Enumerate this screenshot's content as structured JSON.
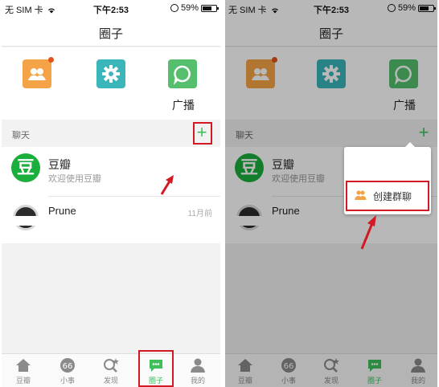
{
  "status_bar": {
    "carrier": "无 SIM 卡",
    "time": "下午2:53",
    "battery": "59%"
  },
  "nav": {
    "title": "圈子"
  },
  "circle_icons": [
    {
      "icon": "group-icon",
      "color": "#f4a446",
      "badge": true,
      "label": ""
    },
    {
      "icon": "gear-icon",
      "color": "#3ab5ba",
      "badge": false,
      "label": ""
    },
    {
      "icon": "speech-bubble-icon",
      "color": "#55bf6e",
      "badge": false,
      "label": "广播"
    }
  ],
  "section": {
    "label": "聊天",
    "add_label": "+"
  },
  "chats": [
    {
      "avatar_text": "豆",
      "name": "豆瓣",
      "preview": "欢迎使用豆瓣"
    },
    {
      "name": "Prune",
      "time": "11月前"
    }
  ],
  "tabbar": [
    {
      "icon": "home-icon",
      "label": "豆瓣",
      "active": false
    },
    {
      "icon": "quote-icon",
      "label": "小事",
      "active": false
    },
    {
      "icon": "discover-icon",
      "label": "发现",
      "active": false
    },
    {
      "icon": "chat-icon",
      "label": "圈子",
      "active": true
    },
    {
      "icon": "person-icon",
      "label": "我的",
      "active": false
    }
  ],
  "popup_menu": {
    "items": [
      {
        "icon": "group-icon",
        "label": "创建群聊"
      }
    ]
  },
  "colors": {
    "accent": "#3ebf5b",
    "highlight": "#d31923",
    "douban_green": "#1aae3c"
  }
}
